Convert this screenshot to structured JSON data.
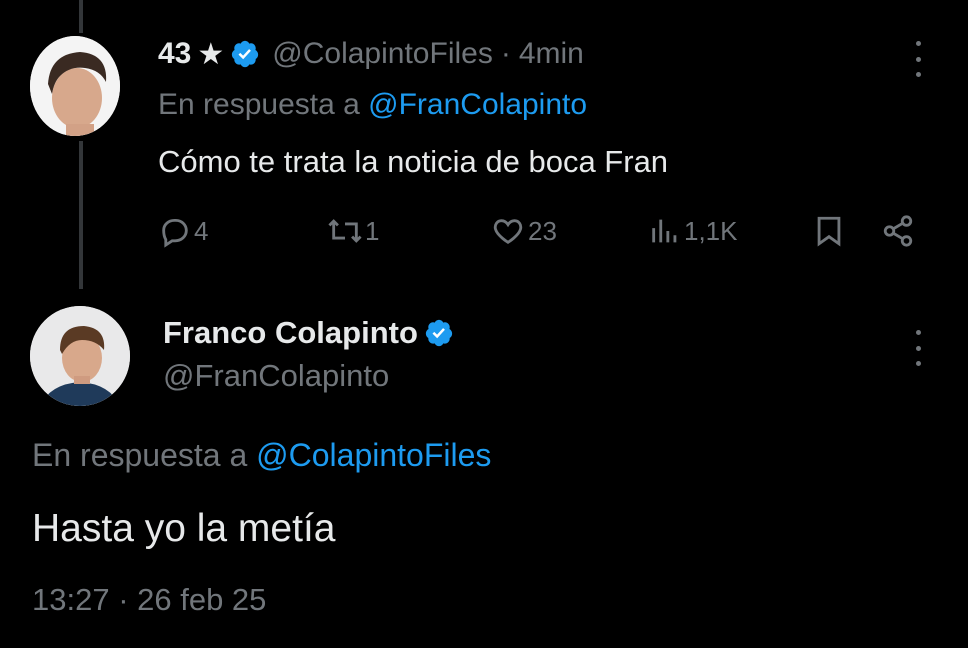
{
  "tweet1": {
    "display_name": "43",
    "star": "★",
    "handle": "@ColapintoFiles",
    "separator": "·",
    "time": "4min",
    "reply_prefix": "En respuesta a",
    "reply_to": "@FranColapinto",
    "text": "Cómo te trata la noticia de boca Fran",
    "actions": {
      "replies": "4",
      "reposts": "1",
      "likes": "23",
      "views": "1,1K"
    }
  },
  "tweet2": {
    "display_name": "Franco Colapinto",
    "handle": "@FranColapinto",
    "reply_prefix": "En respuesta a",
    "reply_to": "@ColapintoFiles",
    "text": "Hasta yo la metía",
    "timestamp": "13:27 · 26 feb 25"
  },
  "colors": {
    "background": "#000000",
    "text": "#e7e9ea",
    "muted": "#71767b",
    "link": "#1d9bf0",
    "verified": "#1d9bf0"
  },
  "icons": [
    "verified-icon",
    "more-icon",
    "reply-icon",
    "repost-icon",
    "like-icon",
    "views-icon",
    "bookmark-icon",
    "share-icon"
  ]
}
